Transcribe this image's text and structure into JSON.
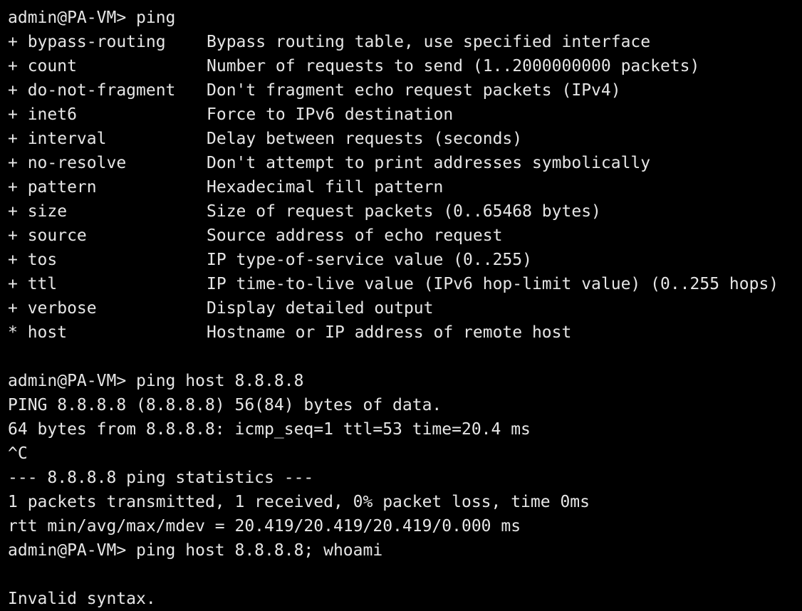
{
  "terminal": {
    "prompt_1": "admin@PA-VM> ping",
    "options": [
      {
        "opt": "+ bypass-routing",
        "desc": "Bypass routing table, use specified interface"
      },
      {
        "opt": "+ count",
        "desc": "Number of requests to send (1..2000000000 packets)"
      },
      {
        "opt": "+ do-not-fragment",
        "desc": "Don't fragment echo request packets (IPv4)"
      },
      {
        "opt": "+ inet6",
        "desc": "Force to IPv6 destination"
      },
      {
        "opt": "+ interval",
        "desc": "Delay between requests (seconds)"
      },
      {
        "opt": "+ no-resolve",
        "desc": "Don't attempt to print addresses symbolically"
      },
      {
        "opt": "+ pattern",
        "desc": "Hexadecimal fill pattern"
      },
      {
        "opt": "+ size",
        "desc": "Size of request packets (0..65468 bytes)"
      },
      {
        "opt": "+ source",
        "desc": "Source address of echo request"
      },
      {
        "opt": "+ tos",
        "desc": "IP type-of-service value (0..255)"
      },
      {
        "opt": "+ ttl",
        "desc": "IP time-to-live value (IPv6 hop-limit value) (0..255 hops)"
      },
      {
        "opt": "+ verbose",
        "desc": "Display detailed output"
      },
      {
        "opt": "* host",
        "desc": "Hostname or IP address of remote host"
      }
    ],
    "prompt_2": "admin@PA-VM> ping host 8.8.8.8",
    "output": [
      "PING 8.8.8.8 (8.8.8.8) 56(84) bytes of data.",
      "64 bytes from 8.8.8.8: icmp_seq=1 ttl=53 time=20.4 ms",
      "^C",
      "--- 8.8.8.8 ping statistics ---",
      "1 packets transmitted, 1 received, 0% packet loss, time 0ms",
      "rtt min/avg/max/mdev = 20.419/20.419/20.419/0.000 ms"
    ],
    "prompt_3": "admin@PA-VM> ping host 8.8.8.8; whoami",
    "error": "Invalid syntax."
  }
}
